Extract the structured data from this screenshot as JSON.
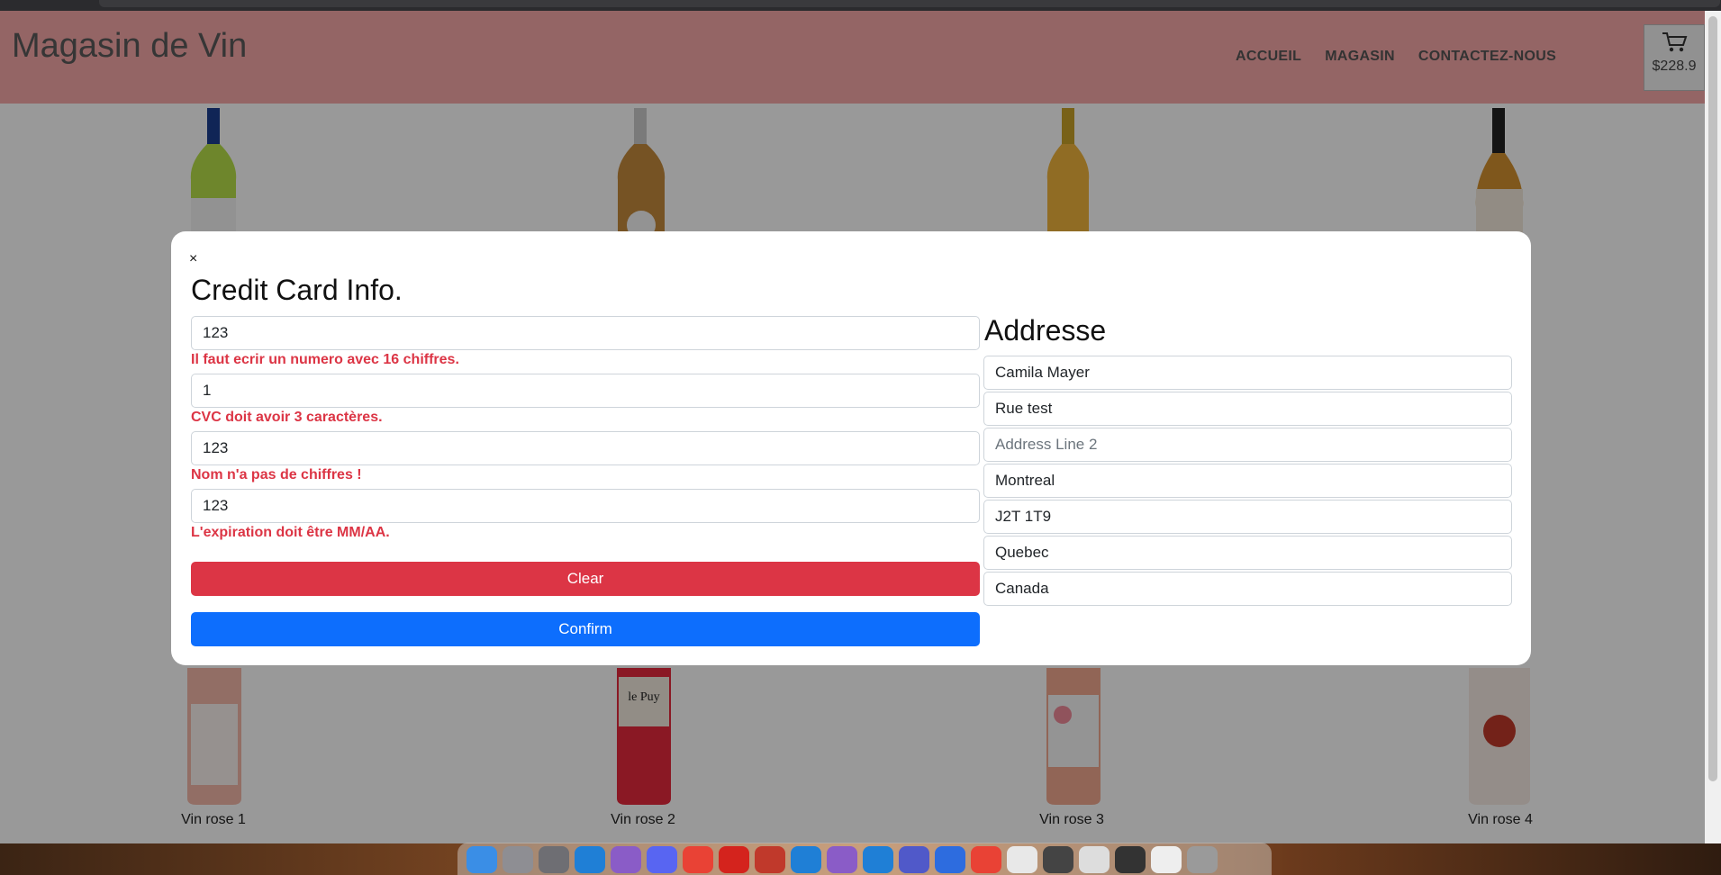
{
  "header": {
    "brand": "Magasin de Vin",
    "nav": [
      "ACCUEIL",
      "MAGASIN",
      "CONTACTEZ-NOUS"
    ],
    "cart_total": "$228.9"
  },
  "products_bottom": [
    "Vin rose 1",
    "Vin rose 2",
    "Vin rose 3",
    "Vin rose 4"
  ],
  "modal": {
    "close": "×",
    "cc_title": "Credit Card Info.",
    "cc_fields": [
      {
        "value": "123",
        "error": "Il faut ecrir un numero avec 16 chiffres."
      },
      {
        "value": "1",
        "error": "CVC doit avoir 3 caractères."
      },
      {
        "value": "123",
        "error": "Nom n'a pas de chiffres !"
      },
      {
        "value": "123",
        "error": "L'expiration doit être MM/AA."
      }
    ],
    "clear_label": "Clear",
    "confirm_label": "Confirm",
    "addr_title": "Addresse",
    "addr_fields": [
      {
        "value": "Camila Mayer",
        "placeholder": ""
      },
      {
        "value": "Rue test",
        "placeholder": ""
      },
      {
        "value": "",
        "placeholder": "Address Line 2"
      },
      {
        "value": "Montreal",
        "placeholder": ""
      },
      {
        "value": "J2T 1T9",
        "placeholder": ""
      },
      {
        "value": "Quebec",
        "placeholder": ""
      },
      {
        "value": "Canada",
        "placeholder": ""
      }
    ]
  },
  "colors": {
    "header_bg": "#f7a8a8",
    "error": "#dc3545",
    "clear_button": "#dc3545",
    "confirm_button": "#0d6efd"
  }
}
